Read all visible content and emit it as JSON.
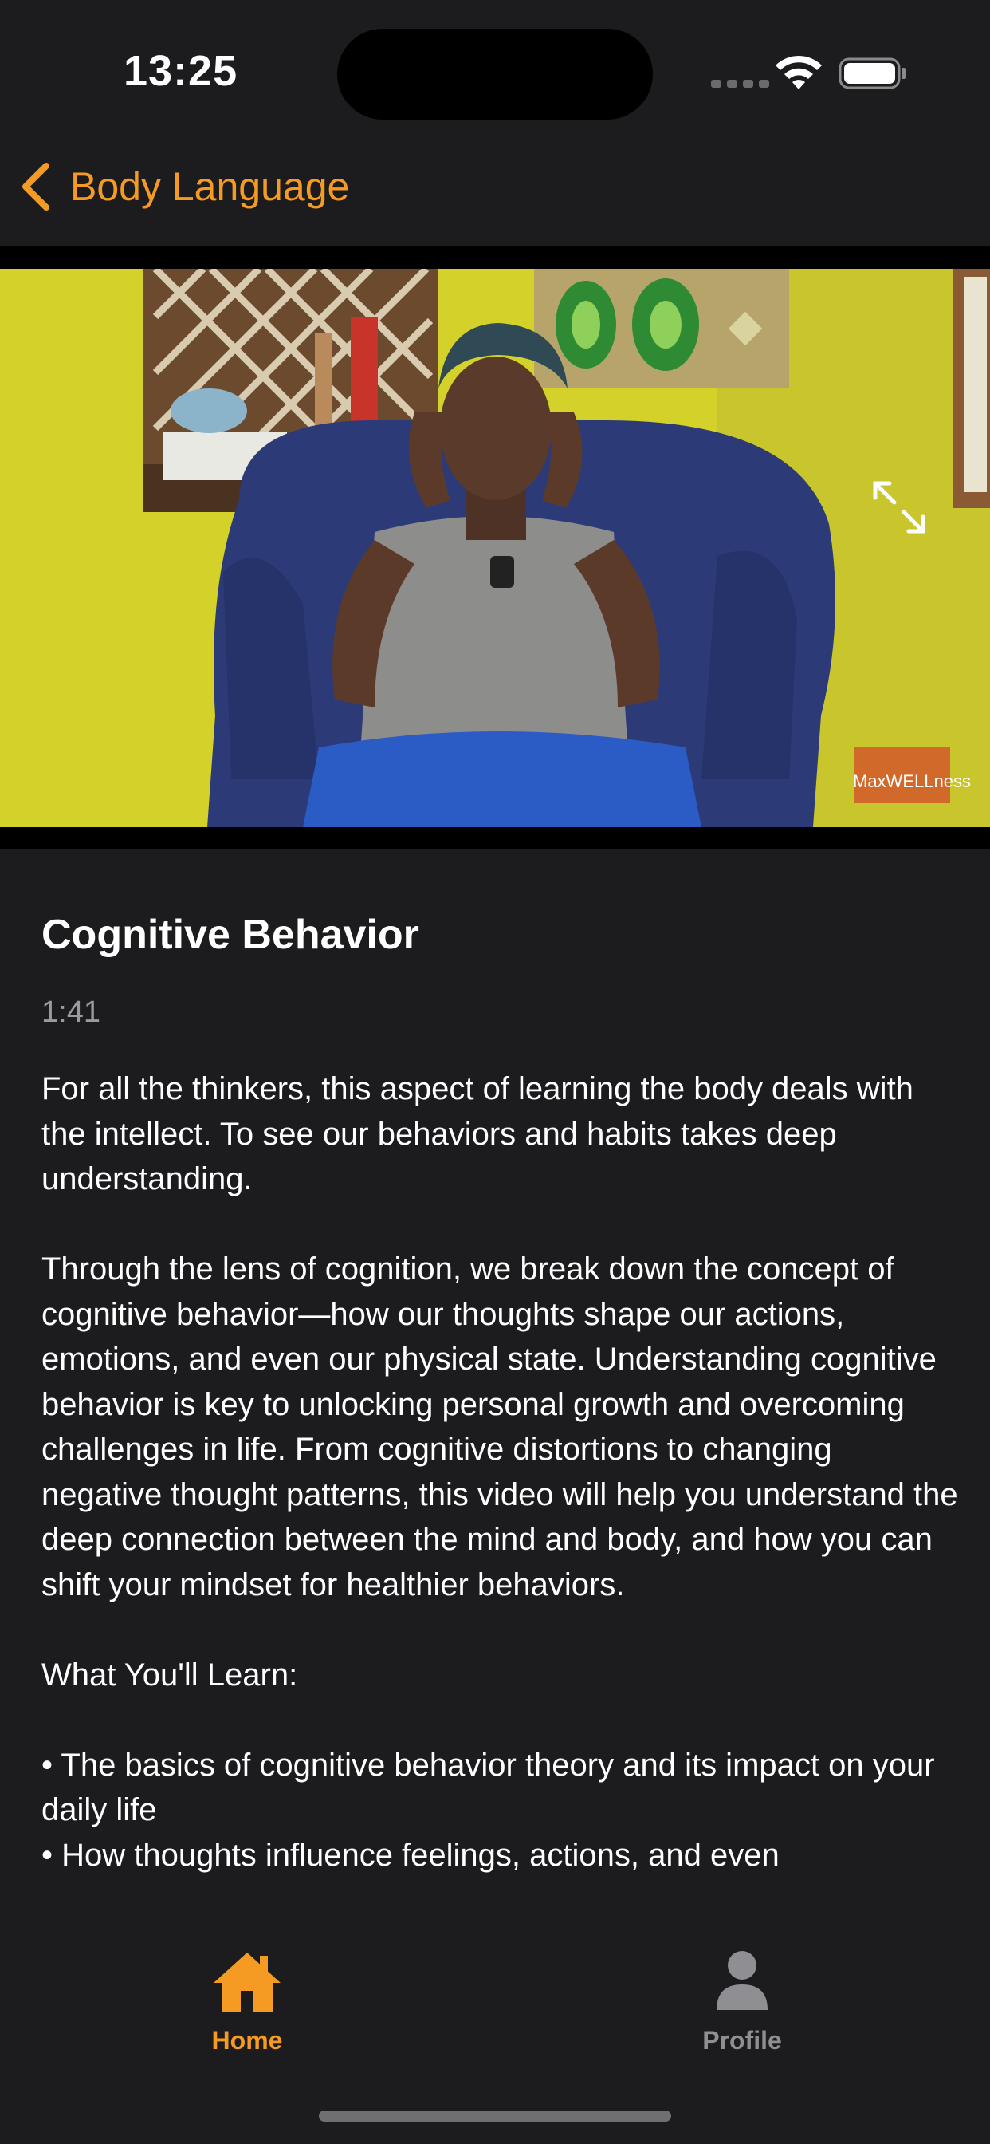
{
  "status_bar": {
    "time": "13:25"
  },
  "nav": {
    "back_label": "Body Language"
  },
  "video": {
    "watermark": "MaxWELLness"
  },
  "content": {
    "title": "Cognitive Behavior",
    "duration": "1:41",
    "description": "For all the thinkers, this aspect of learning the body deals with the intellect. To see our behaviors and habits takes deep understanding.\n\nThrough the lens of cognition, we break down the concept of cognitive behavior—how our thoughts shape our actions, emotions, and even our physical state. Understanding cognitive behavior is key to unlocking personal growth and overcoming challenges in life. From cognitive distortions to changing negative thought patterns, this video will help you understand the deep connection between the mind and body, and how you can shift your mindset for healthier behaviors.\n\nWhat You'll Learn:\n\n • The basics of cognitive behavior theory and its impact on your daily life\n • How thoughts influence feelings, actions, and even"
  },
  "tab_bar": {
    "tabs": [
      {
        "label": "Home",
        "icon": "house-icon",
        "selected": true
      },
      {
        "label": "Profile",
        "icon": "person-icon",
        "selected": false
      }
    ]
  },
  "colors": {
    "accent": "#f59a23",
    "background": "#1c1c1e",
    "secondary_text": "#9a9a9f",
    "inactive_tab": "#8e8e93"
  }
}
